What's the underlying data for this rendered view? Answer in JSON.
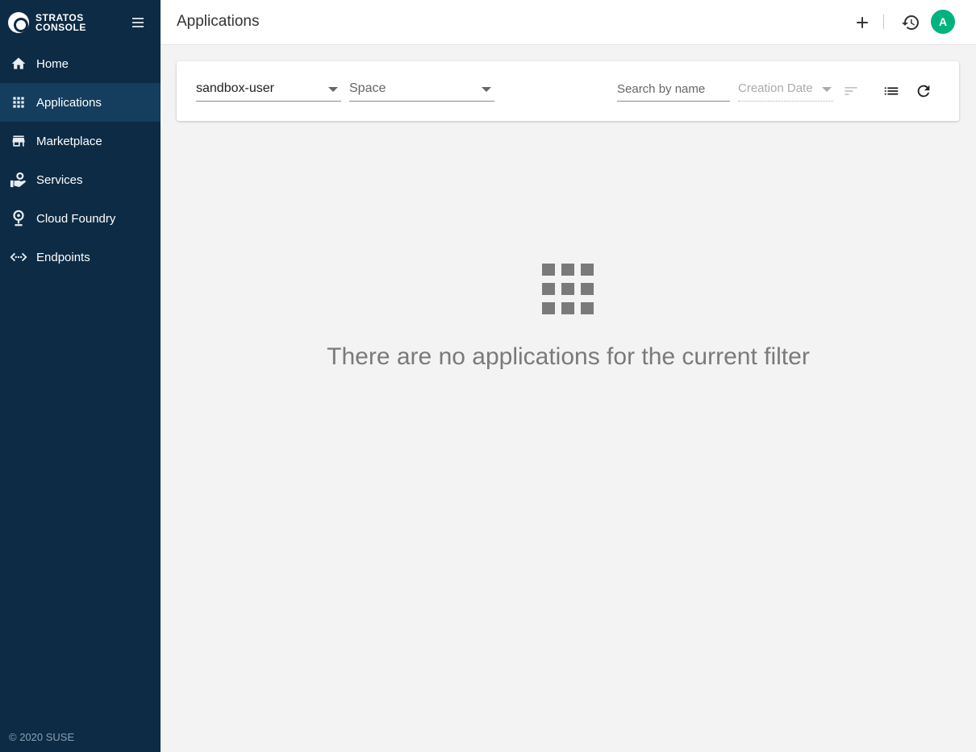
{
  "app": {
    "logo_line1": "STRATOS",
    "logo_line2": "CONSOLE",
    "footer": "© 2020 SUSE"
  },
  "sidebar": {
    "items": [
      {
        "label": "Home",
        "icon": "home-icon"
      },
      {
        "label": "Applications",
        "icon": "apps-grid-icon",
        "active": true
      },
      {
        "label": "Marketplace",
        "icon": "store-icon"
      },
      {
        "label": "Services",
        "icon": "services-icon"
      },
      {
        "label": "Cloud Foundry",
        "icon": "cloud-foundry-icon"
      },
      {
        "label": "Endpoints",
        "icon": "endpoints-icon"
      }
    ]
  },
  "header": {
    "title": "Applications",
    "avatar_initial": "A"
  },
  "filters": {
    "org_value": "sandbox-user",
    "space_placeholder": "Space",
    "search_placeholder": "Search by name",
    "sort_value": "Creation Date"
  },
  "empty_state": {
    "message": "There are no applications for the current filter"
  },
  "colors": {
    "sidebar": "#0d2b45",
    "sidebar_active": "#153d5e",
    "avatar": "#00b37e",
    "empty": "#7a7a7a"
  }
}
